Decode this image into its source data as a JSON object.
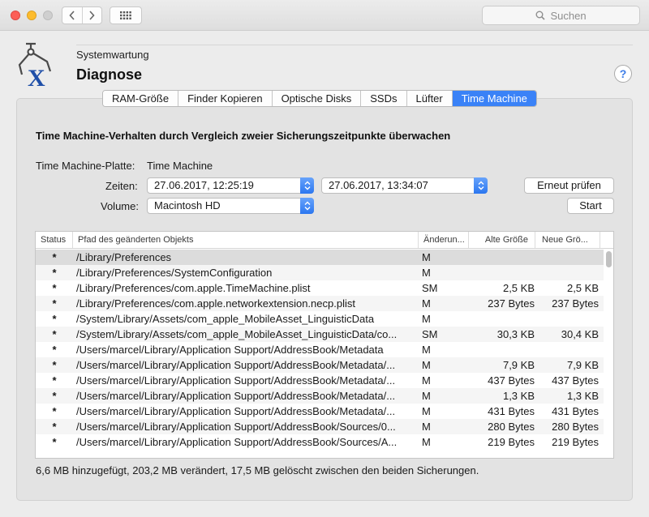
{
  "toolbar": {
    "back_icon": "chevron-left-icon",
    "forward_icon": "chevron-right-icon",
    "grid_icon": "grid-icon",
    "search_placeholder": "Suchen"
  },
  "header": {
    "section": "Systemwartung",
    "title": "Diagnose",
    "help_label": "?"
  },
  "tabs": [
    {
      "label": "RAM-Größe"
    },
    {
      "label": "Finder Kopieren"
    },
    {
      "label": "Optische Disks"
    },
    {
      "label": "SSDs"
    },
    {
      "label": "Lüfter"
    },
    {
      "label": "Time Machine",
      "active": true
    }
  ],
  "panel": {
    "heading": "Time Machine-Verhalten durch Vergleich zweier Sicherungszeitpunkte überwachen",
    "disk_label": "Time Machine-Platte:",
    "disk_value": "Time Machine",
    "times_label": "Zeiten:",
    "time1": "27.06.2017, 12:25:19",
    "time2": "27.06.2017, 13:34:07",
    "volume_label": "Volume:",
    "volume_value": "Macintosh HD",
    "recheck_button": "Erneut prüfen",
    "start_button": "Start"
  },
  "table": {
    "columns": [
      "Status",
      "Pfad des geänderten Objekts",
      "Änderun...",
      "Alte Größe",
      "Neue Grö..."
    ],
    "rows": [
      {
        "status": "*",
        "path": "/Library/Preferences",
        "change": "M",
        "old": "",
        "new": ""
      },
      {
        "status": "*",
        "path": "/Library/Preferences/SystemConfiguration",
        "change": "M",
        "old": "",
        "new": ""
      },
      {
        "status": "*",
        "path": "/Library/Preferences/com.apple.TimeMachine.plist",
        "change": "SM",
        "old": "2,5 KB",
        "new": "2,5 KB"
      },
      {
        "status": "*",
        "path": "/Library/Preferences/com.apple.networkextension.necp.plist",
        "change": "M",
        "old": "237 Bytes",
        "new": "237 Bytes"
      },
      {
        "status": "*",
        "path": "/System/Library/Assets/com_apple_MobileAsset_LinguisticData",
        "change": "M",
        "old": "",
        "new": ""
      },
      {
        "status": "*",
        "path": "/System/Library/Assets/com_apple_MobileAsset_LinguisticData/co...",
        "change": "SM",
        "old": "30,3 KB",
        "new": "30,4 KB"
      },
      {
        "status": "*",
        "path": "/Users/marcel/Library/Application Support/AddressBook/Metadata",
        "change": "M",
        "old": "",
        "new": ""
      },
      {
        "status": "*",
        "path": "/Users/marcel/Library/Application Support/AddressBook/Metadata/...",
        "change": "M",
        "old": "7,9 KB",
        "new": "7,9 KB"
      },
      {
        "status": "*",
        "path": "/Users/marcel/Library/Application Support/AddressBook/Metadata/...",
        "change": "M",
        "old": "437 Bytes",
        "new": "437 Bytes"
      },
      {
        "status": "*",
        "path": "/Users/marcel/Library/Application Support/AddressBook/Metadata/...",
        "change": "M",
        "old": "1,3 KB",
        "new": "1,3 KB"
      },
      {
        "status": "*",
        "path": "/Users/marcel/Library/Application Support/AddressBook/Metadata/...",
        "change": "M",
        "old": "431 Bytes",
        "new": "431 Bytes"
      },
      {
        "status": "*",
        "path": "/Users/marcel/Library/Application Support/AddressBook/Sources/0...",
        "change": "M",
        "old": "280 Bytes",
        "new": "280 Bytes"
      },
      {
        "status": "*",
        "path": "/Users/marcel/Library/Application Support/AddressBook/Sources/A...",
        "change": "M",
        "old": "219 Bytes",
        "new": "219 Bytes"
      }
    ]
  },
  "summary": "6,6 MB hinzugefügt, 203,2 MB verändert, 17,5 MB gelöscht zwischen den beiden Sicherungen.",
  "colors": {
    "accent": "#3a82f7"
  }
}
